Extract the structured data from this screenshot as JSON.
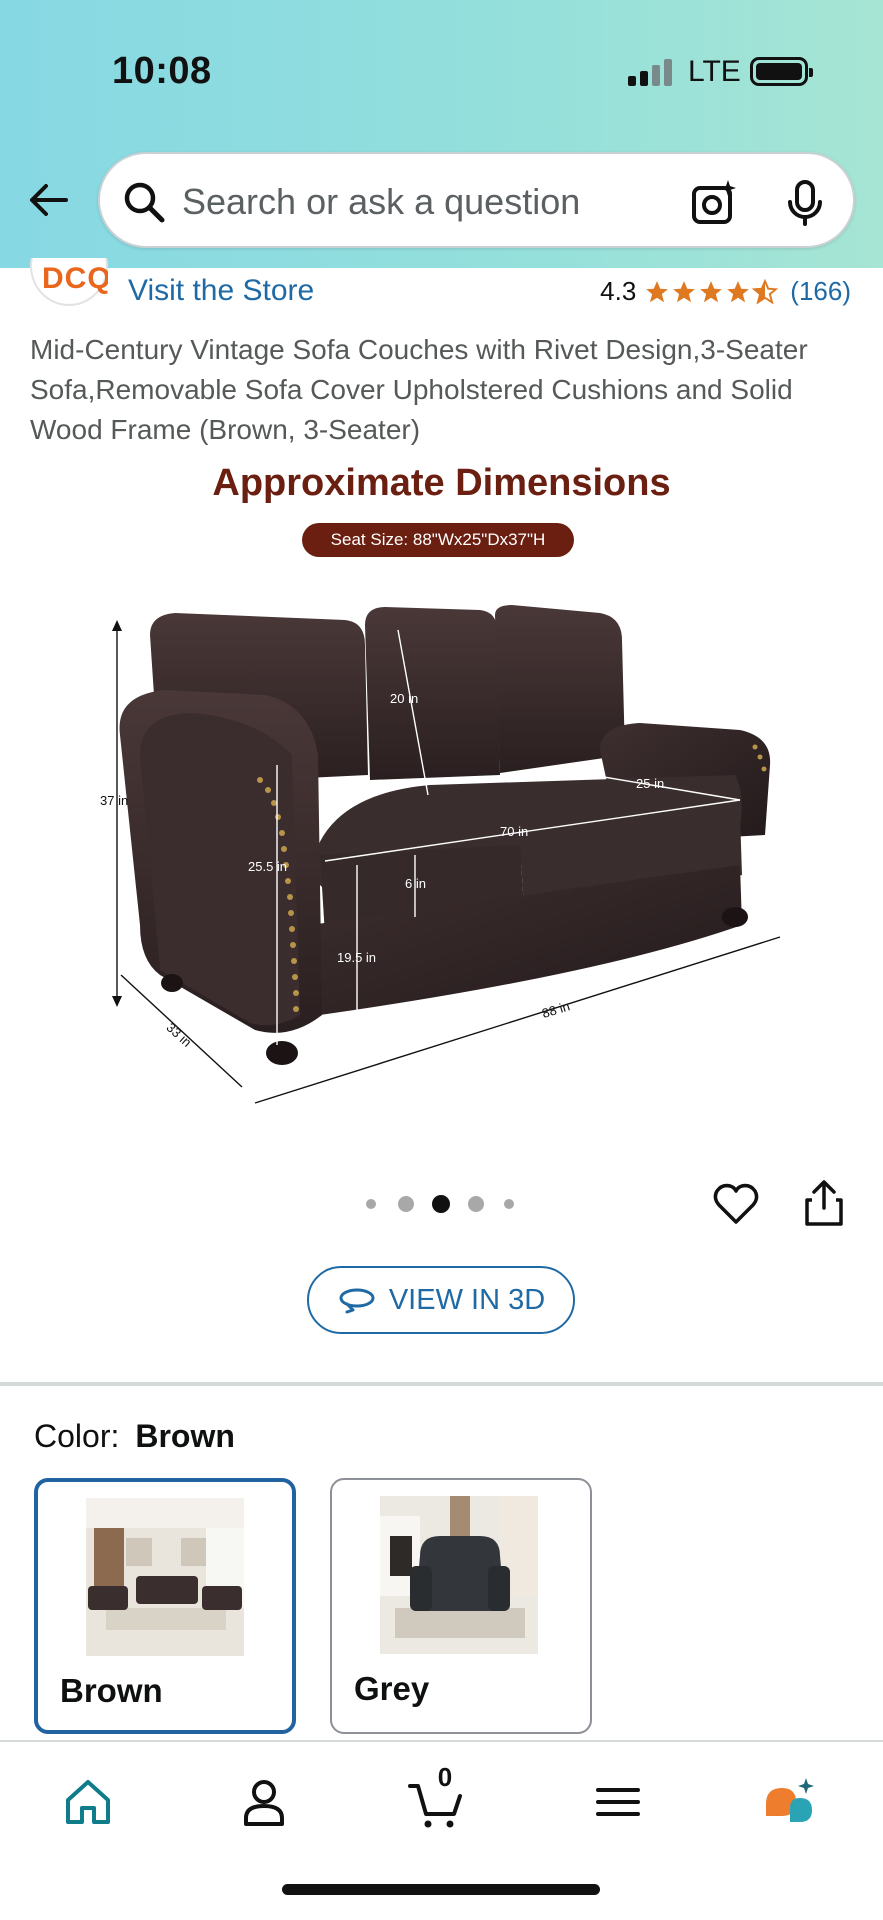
{
  "status_bar": {
    "time": "10:08",
    "network": "LTE"
  },
  "search": {
    "placeholder": "Search or ask a question",
    "value": ""
  },
  "store": {
    "logo_text": "DCQ",
    "link_label": "Visit the Store"
  },
  "rating": {
    "value": "4.3",
    "stars": 4.3,
    "count": "(166)"
  },
  "product": {
    "title": "Mid-Century Vintage Sofa Couches with Rivet Design,3-Seater Sofa,Removable Sofa Cover Upholstered Cushions and Solid Wood Frame (Brown, 3-Seater)"
  },
  "image": {
    "heading": "Approximate Dimensions",
    "badge": "Seat Size: 88\"Wx25\"Dx37\"H",
    "labels": {
      "height": "37 in",
      "depth": "33 in",
      "width": "88 in",
      "back": "20 in",
      "seat_depth": "25 in",
      "seat_width": "70 in",
      "arm": "25.5 in",
      "cushion": "6 in",
      "seat_height": "19.5 in"
    },
    "dots": {
      "count": 5,
      "active": 2
    }
  },
  "view3d": {
    "label": "VIEW IN 3D"
  },
  "color": {
    "label": "Color:",
    "selected": "Brown",
    "options": [
      {
        "label": "Brown",
        "selected": true
      },
      {
        "label": "Grey",
        "selected": false
      }
    ]
  },
  "nav": {
    "cart_count": "0",
    "items": [
      "home",
      "account",
      "cart",
      "menu",
      "rufus"
    ]
  },
  "colors": {
    "accent_link": "#1f6aa5",
    "star": "#de7921",
    "heading_brown": "#6a1f10",
    "selected_border": "#2162a1",
    "header_teal": "#93dfdc"
  }
}
